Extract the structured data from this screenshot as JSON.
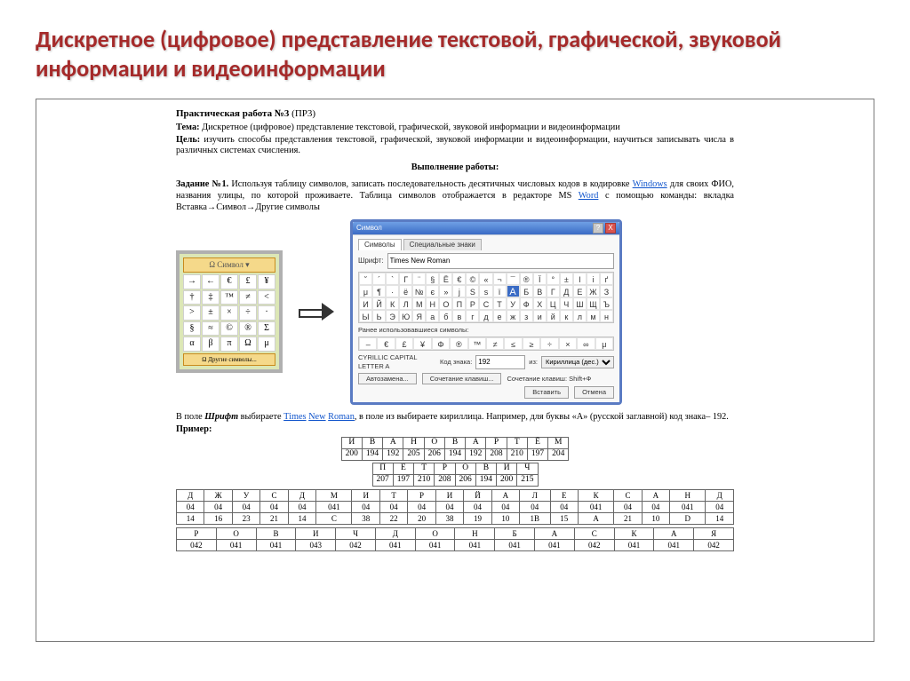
{
  "slide": {
    "title": "Дискретное (цифровое) представление текстовой, графической, звуковой информации и видеоинформации"
  },
  "doc": {
    "heading_prefix": "Практическая работа №3",
    "heading_suffix": " (ПР3)",
    "topic_label": "Тема:",
    "topic_text": " Дискретное (цифровое) представление текстовой, графической, звуковой информации и видеоинформации",
    "goal_label": "Цель:",
    "goal_text": " изучить способы представления текстовой, графической, звуковой информации и видеоинформации, научиться записывать числа в различных системах счисления.",
    "work_header": "Выполнение работы:",
    "task1_label": "Задание №1.",
    "task1_text1": " Используя таблицу символов, записать последовательность десятичных числовых кодов в кодировке ",
    "windows_word": "Windows",
    "task1_text2": " для своих ФИО, названия улицы, по которой проживаете. Таблица символов отображается в редакторе MS ",
    "word_word": "Word",
    "task1_text3": " с помощью команды: вкладка Вставка→Символ→Другие символы",
    "symbox": {
      "header": "Ω Символ ▾",
      "chars": [
        "→",
        "←",
        "€",
        "£",
        "¥",
        "†",
        "‡",
        "™",
        "≠",
        "<",
        ">",
        "±",
        "×",
        "÷",
        "·",
        "§",
        "≈",
        "©",
        "®",
        "Σ",
        "α",
        "β",
        "π",
        "Ω",
        "μ"
      ],
      "footer": "Ω Другие символы..."
    },
    "dialog": {
      "title": "Символ",
      "close_x": "X",
      "tab1": "Символы",
      "tab2": "Специальные знаки",
      "font_label": "Шрифт:",
      "font_value": "Times New Roman",
      "grid": [
        "˘",
        "´",
        "`",
        "Γ",
        "¨",
        "§",
        "Ё",
        "€",
        "©",
        "«",
        "¬",
        "¯",
        "®",
        "Ї",
        "°",
        "±",
        "І",
        "і",
        "ґ",
        "μ",
        "¶",
        "·",
        "ё",
        "№",
        "є",
        "»",
        "ј",
        "Ѕ",
        "ѕ",
        "ї",
        "А",
        "Б",
        "В",
        "Г",
        "Д",
        "Е",
        "Ж",
        "З",
        "И",
        "Й",
        "К",
        "Л",
        "М",
        "Н",
        "О",
        "П",
        "Р",
        "С",
        "Т",
        "У",
        "Ф",
        "Х",
        "Ц",
        "Ч",
        "Ш",
        "Щ",
        "Ъ",
        "Ы",
        "Ь",
        "Э",
        "Ю",
        "Я",
        "а",
        "б",
        "в",
        "г",
        "д",
        "е",
        "ж",
        "з",
        "и",
        "й",
        "к",
        "л",
        "м",
        "н"
      ],
      "highlight_index": 30,
      "recent_label": "Ранее использовавшиеся символы:",
      "recent": [
        "–",
        "€",
        "£",
        "¥",
        "Φ",
        "®",
        "™",
        "≠",
        "≤",
        "≥",
        "÷",
        "×",
        "∞",
        "μ"
      ],
      "name_label": "CYRILLIC CAPITAL LETTER A",
      "code_label": "Код знака:",
      "code_value": "192",
      "from_label": "из:",
      "from_value": "Кириллица (дес.)",
      "btn_auto": "Автозамена...",
      "btn_shortcut": "Сочетание клавиш...",
      "shortcut_label": "Сочетание клавиш: Shift+Ф",
      "btn_insert": "Вставить",
      "btn_cancel": "Отмена"
    },
    "p2_prefix": "В поле ",
    "p2_bold": "Шрифт",
    "p2_mid": " выбираете ",
    "times": "Times",
    "new": "New",
    "roman": "Roman",
    "p2_tail": ", в поле из выбираете кириллица. Например, для буквы «А» (русской заглавной) код знака– 192.",
    "ex_label": "Пример:",
    "table1": {
      "row1": [
        "И",
        "В",
        "А",
        "Н",
        "О",
        "В",
        "А",
        "Р",
        "Т",
        "Ё",
        "М"
      ],
      "row2": [
        "200",
        "194",
        "192",
        "205",
        "206",
        "194",
        "192",
        "208",
        "210",
        "197",
        "204"
      ]
    },
    "table2": {
      "row1": [
        "П",
        "Е",
        "Т",
        "Р",
        "О",
        "В",
        "И",
        "Ч"
      ],
      "row2": [
        "207",
        "197",
        "210",
        "208",
        "206",
        "194",
        "200",
        "215"
      ]
    },
    "wide1": {
      "row1": [
        "Д",
        "Ж",
        "У",
        "С",
        "Д",
        "М",
        "И",
        "Т",
        "Р",
        "И",
        "Й",
        "А",
        "Л",
        "Е",
        "К",
        "С",
        "А",
        "Н",
        "Д"
      ],
      "row2": [
        "04",
        "04",
        "04",
        "04",
        "04",
        "041",
        "04",
        "04",
        "04",
        "04",
        "04",
        "04",
        "04",
        "04",
        "041",
        "04",
        "04",
        "041",
        "04"
      ],
      "row3": [
        "14",
        "16",
        "23",
        "21",
        "14",
        "С",
        "38",
        "22",
        "20",
        "38",
        "19",
        "10",
        "1В",
        "15",
        "А",
        "21",
        "10",
        "D",
        "14"
      ]
    },
    "wide2": {
      "row1": [
        "Р",
        "О",
        "В",
        "И",
        "Ч",
        "Д",
        "О",
        "Н",
        "Б",
        "А",
        "С",
        "К",
        "А",
        "Я"
      ],
      "row2": [
        "042",
        "041",
        "041",
        "043",
        "042",
        "041",
        "041",
        "041",
        "041",
        "041",
        "042",
        "041",
        "041",
        "042"
      ]
    }
  }
}
